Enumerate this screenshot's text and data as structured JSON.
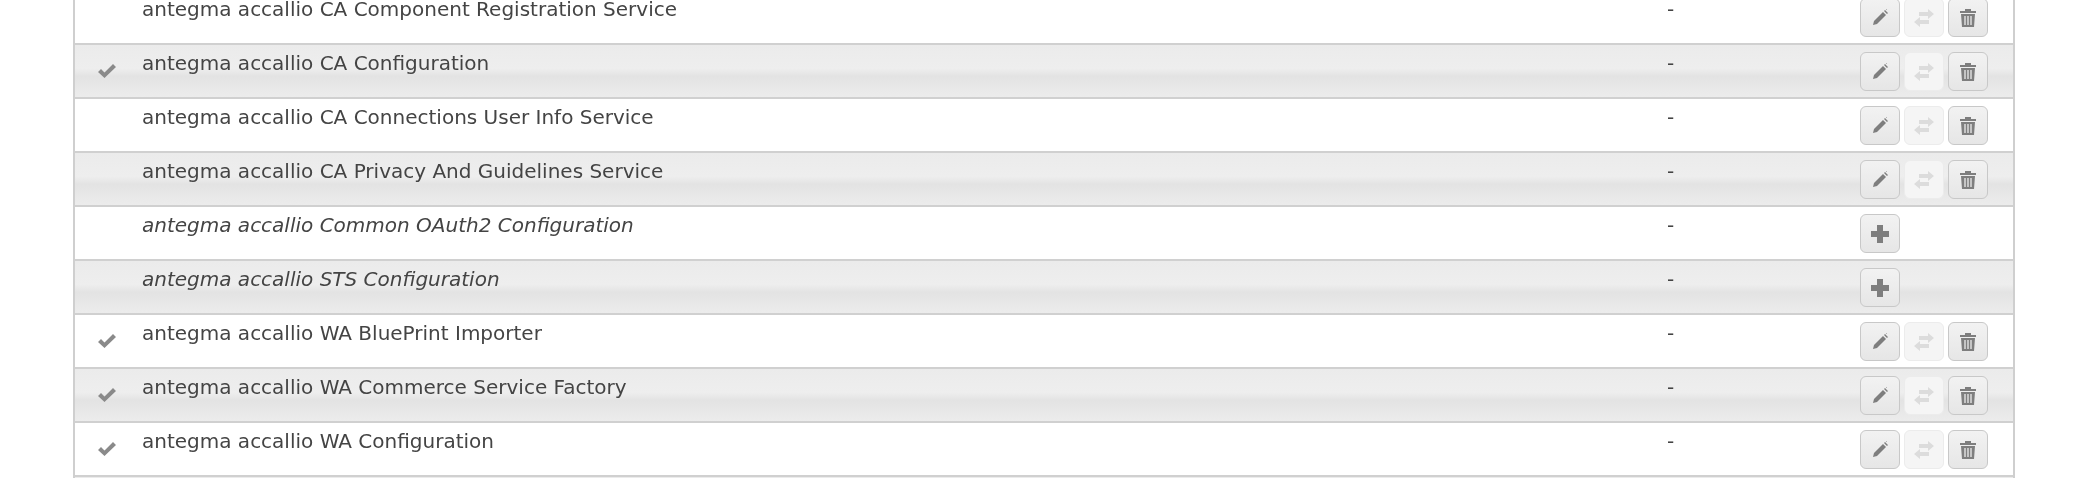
{
  "table": {
    "rows": [
      {
        "kind": "configuration",
        "checked": false,
        "name": "antegma accallio CA Component Registration Service",
        "value": "-",
        "actions": [
          {
            "kind": "edit",
            "disabled": false
          },
          {
            "kind": "swap",
            "disabled": true
          },
          {
            "kind": "delete",
            "disabled": false
          }
        ]
      },
      {
        "kind": "configuration",
        "checked": true,
        "name": "antegma accallio CA Configuration",
        "value": "-",
        "actions": [
          {
            "kind": "edit",
            "disabled": false
          },
          {
            "kind": "swap",
            "disabled": true
          },
          {
            "kind": "delete",
            "disabled": false
          }
        ]
      },
      {
        "kind": "configuration",
        "checked": false,
        "name": "antegma accallio CA Connections User Info Service",
        "value": "-",
        "actions": [
          {
            "kind": "edit",
            "disabled": false
          },
          {
            "kind": "swap",
            "disabled": true
          },
          {
            "kind": "delete",
            "disabled": false
          }
        ]
      },
      {
        "kind": "configuration",
        "checked": false,
        "name": "antegma accallio CA Privacy And Guidelines Service",
        "value": "-",
        "actions": [
          {
            "kind": "edit",
            "disabled": false
          },
          {
            "kind": "swap",
            "disabled": true
          },
          {
            "kind": "delete",
            "disabled": false
          }
        ]
      },
      {
        "kind": "factory",
        "checked": false,
        "name": "antegma accallio Common OAuth2 Configuration",
        "value": "-",
        "actions": [
          {
            "kind": "add",
            "disabled": false
          }
        ]
      },
      {
        "kind": "factory",
        "checked": false,
        "name": "antegma accallio STS Configuration",
        "value": "-",
        "actions": [
          {
            "kind": "add",
            "disabled": false
          }
        ]
      },
      {
        "kind": "configuration",
        "checked": true,
        "name": "antegma accallio WA BluePrint Importer",
        "value": "-",
        "actions": [
          {
            "kind": "edit",
            "disabled": false
          },
          {
            "kind": "swap",
            "disabled": true
          },
          {
            "kind": "delete",
            "disabled": false
          }
        ]
      },
      {
        "kind": "configuration",
        "checked": true,
        "name": "antegma accallio WA Commerce Service Factory",
        "value": "-",
        "actions": [
          {
            "kind": "edit",
            "disabled": false
          },
          {
            "kind": "swap",
            "disabled": true
          },
          {
            "kind": "delete",
            "disabled": false
          }
        ]
      },
      {
        "kind": "configuration",
        "checked": true,
        "name": "antegma accallio WA Configuration",
        "value": "-",
        "actions": [
          {
            "kind": "edit",
            "disabled": false
          },
          {
            "kind": "swap",
            "disabled": true
          },
          {
            "kind": "delete",
            "disabled": false
          }
        ]
      }
    ]
  }
}
